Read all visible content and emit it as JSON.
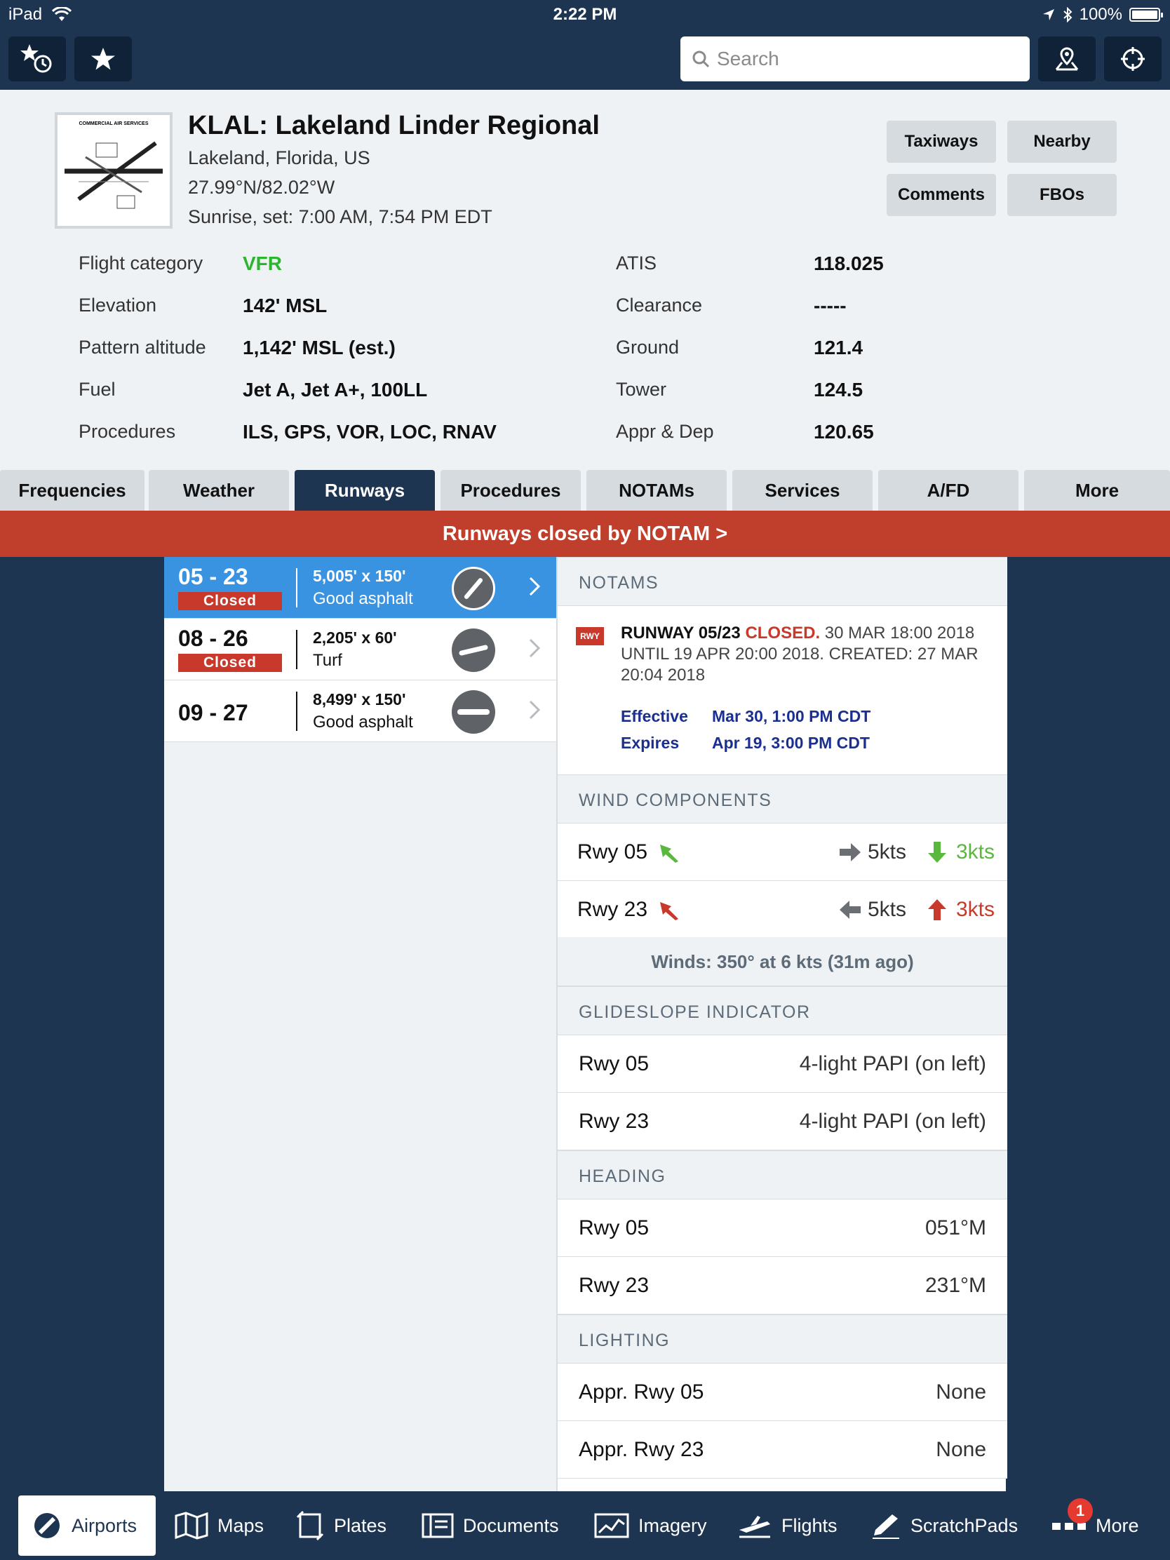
{
  "status_bar": {
    "device": "iPad",
    "time": "2:22 PM",
    "battery": "100%"
  },
  "search": {
    "placeholder": "Search"
  },
  "airport": {
    "title": "KLAL: Lakeland Linder Regional",
    "location": "Lakeland, Florida, US",
    "coordinates": "27.99°N/82.02°W",
    "sunrise": "Sunrise, set: 7:00 AM, 7:54 PM EDT",
    "thumbnail_caption": "COMMERCIAL AIR SERVICES"
  },
  "header_buttons": {
    "taxiways": "Taxiways",
    "nearby": "Nearby",
    "comments": "Comments",
    "fbos": "FBOs"
  },
  "info_left": [
    {
      "label": "Flight category",
      "value": "VFR"
    },
    {
      "label": "Elevation",
      "value": "142' MSL"
    },
    {
      "label": "Pattern altitude",
      "value": "1,142' MSL (est.)"
    },
    {
      "label": "Fuel",
      "value": "Jet A, Jet A+, 100LL"
    },
    {
      "label": "Procedures",
      "value": "ILS, GPS, VOR, LOC, RNAV"
    }
  ],
  "info_right": [
    {
      "label": "ATIS",
      "value": "118.025"
    },
    {
      "label": "Clearance",
      "value": "-----"
    },
    {
      "label": "Ground",
      "value": "121.4"
    },
    {
      "label": "Tower",
      "value": "124.5"
    },
    {
      "label": "Appr & Dep",
      "value": "120.65"
    }
  ],
  "tabs": [
    "Frequencies",
    "Weather",
    "Runways",
    "Procedures",
    "NOTAMs",
    "Services",
    "A/FD",
    "More"
  ],
  "banner": "Runways closed by NOTAM >",
  "runways": [
    {
      "id": "05 - 23",
      "closed": "Closed",
      "dims": "5,005' x 150'",
      "surface": "Good asphalt"
    },
    {
      "id": "08 - 26",
      "closed": "Closed",
      "dims": "2,205' x 60'",
      "surface": "Turf"
    },
    {
      "id": "09 - 27",
      "closed": "",
      "dims": "8,499' x 150'",
      "surface": "Good asphalt"
    }
  ],
  "notams": {
    "header": "NOTAMS",
    "badge": "RWY",
    "text_bold": "RUNWAY 05/23",
    "text_closed": "CLOSED.",
    "text_rest": "30 MAR 18:00 2018 UNTIL 19 APR 20:00 2018. CREATED: 27 MAR 20:04 2018",
    "effective_label": "Effective",
    "effective_value": "Mar 30, 1:00 PM CDT",
    "expires_label": "Expires",
    "expires_value": "Apr 19, 3:00 PM CDT"
  },
  "wind": {
    "header": "WIND COMPONENTS",
    "rows": [
      {
        "rwy": "Rwy 05",
        "cross": "5kts",
        "head": "3kts"
      },
      {
        "rwy": "Rwy 23",
        "cross": "5kts",
        "head": "3kts"
      }
    ],
    "summary": "Winds: 350° at 6 kts (31m ago)"
  },
  "glideslope": {
    "header": "GLIDESLOPE INDICATOR",
    "rows": [
      {
        "label": "Rwy 05",
        "value": "4-light PAPI (on left)"
      },
      {
        "label": "Rwy 23",
        "value": "4-light PAPI (on left)"
      }
    ]
  },
  "heading": {
    "header": "HEADING",
    "rows": [
      {
        "label": "Rwy 05",
        "value": "051°M"
      },
      {
        "label": "Rwy 23",
        "value": "231°M"
      }
    ]
  },
  "lighting": {
    "header": "LIGHTING",
    "rows": [
      {
        "label": "Appr. Rwy 05",
        "value": "None"
      },
      {
        "label": "Appr. Rwy 23",
        "value": "None"
      }
    ]
  },
  "tabbar": [
    "Airports",
    "Maps",
    "Plates",
    "Documents",
    "Imagery",
    "Flights",
    "ScratchPads",
    "More"
  ],
  "tabbar_badge": "1",
  "colors": {
    "navy": "#1e3552",
    "selected_blue": "#3a93e0",
    "closed_red": "#c8392b",
    "vfr_green": "#2db52d"
  }
}
